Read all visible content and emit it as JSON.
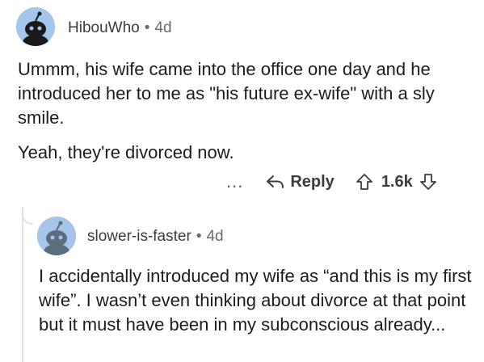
{
  "comment1": {
    "username": "HibouWho",
    "time": "4d",
    "paragraphs": [
      "Ummm, his wife came into the office one day and he introduced her to me as \"his future ex-wife\" with a sly smile.",
      "Yeah, they're divorced now."
    ],
    "actions": {
      "more": "...",
      "reply_label": "Reply",
      "vote_count": "1.6k"
    }
  },
  "comment2": {
    "username": "slower-is-faster",
    "time": "4d",
    "paragraphs": [
      "I accidentally introduced my wife as “and this is my first wife”. I wasn’t even thinking about divorce at that point but it must have been in my subconscious already..."
    ]
  },
  "colors": {
    "avatar_bg": "#a5c5ea",
    "text": "#1c1c1c",
    "meta": "#3c3c3c"
  },
  "icons": [
    "reply-icon",
    "upvote-icon",
    "downvote-icon",
    "more-icon",
    "avatar-icon"
  ]
}
